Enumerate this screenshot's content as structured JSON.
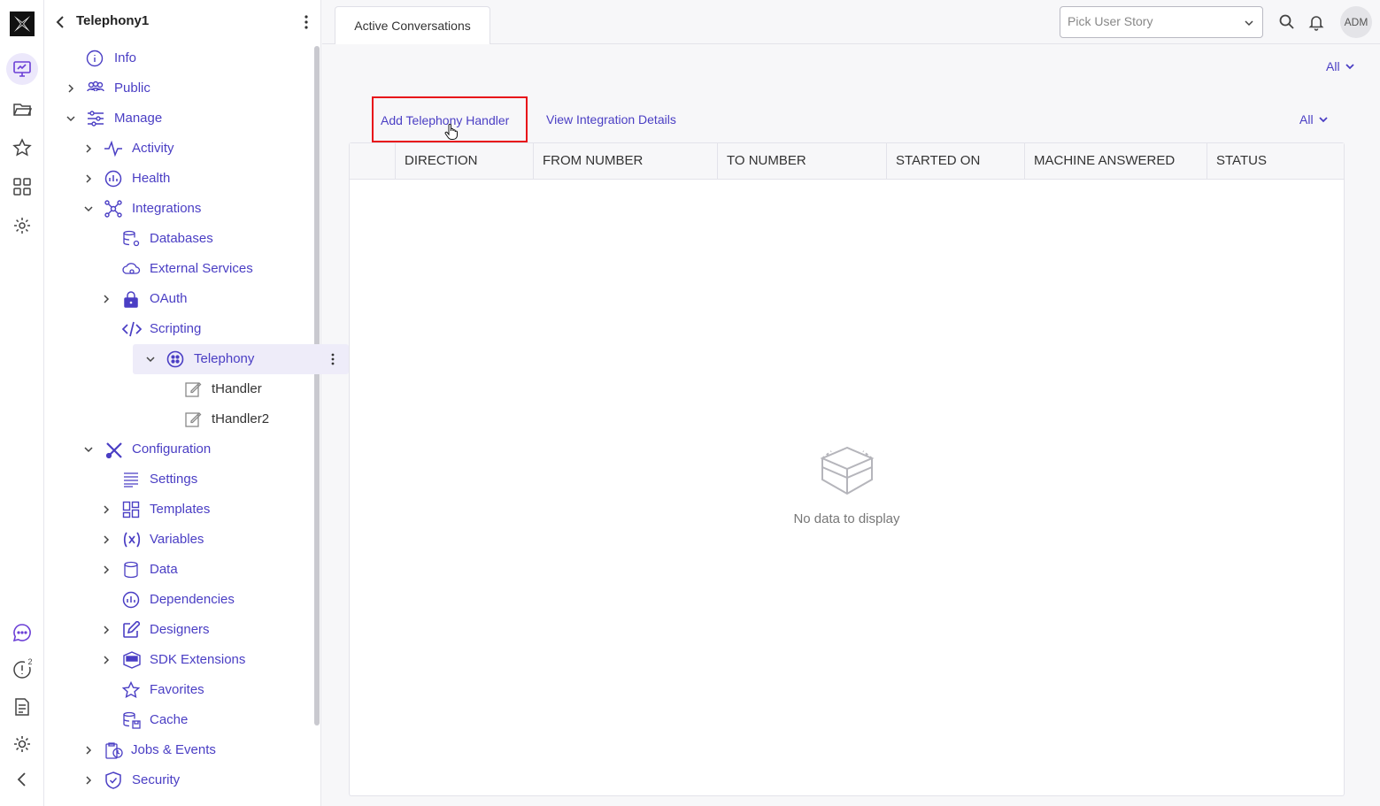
{
  "app": {
    "project_title": "Telephony1"
  },
  "rail": {
    "badge_count": "2"
  },
  "sidebar": {
    "items": [
      {
        "label": "Info",
        "icon": "info-icon"
      },
      {
        "label": "Public",
        "icon": "people-icon"
      },
      {
        "label": "Manage",
        "icon": "sliders-icon"
      },
      {
        "label": "Activity",
        "icon": "pulse-icon"
      },
      {
        "label": "Health",
        "icon": "gauge-icon"
      },
      {
        "label": "Integrations",
        "icon": "network-icon"
      },
      {
        "label": "Databases",
        "icon": "database-gear-icon"
      },
      {
        "label": "External Services",
        "icon": "cloud-gear-icon"
      },
      {
        "label": "OAuth",
        "icon": "lock-icon"
      },
      {
        "label": "Scripting",
        "icon": "code-icon"
      },
      {
        "label": "Telephony",
        "icon": "telephony-icon"
      },
      {
        "label": "tHandler",
        "icon": "edit-icon"
      },
      {
        "label": "tHandler2",
        "icon": "edit-icon"
      },
      {
        "label": "Configuration",
        "icon": "tools-icon"
      },
      {
        "label": "Settings",
        "icon": "lines-icon"
      },
      {
        "label": "Templates",
        "icon": "grid-icon"
      },
      {
        "label": "Variables",
        "icon": "variable-icon"
      },
      {
        "label": "Data",
        "icon": "cylinder-icon"
      },
      {
        "label": "Dependencies",
        "icon": "gauge-icon"
      },
      {
        "label": "Designers",
        "icon": "pencil-square-icon"
      },
      {
        "label": "SDK Extensions",
        "icon": "sdk-icon"
      },
      {
        "label": "Favorites",
        "icon": "star-icon"
      },
      {
        "label": "Cache",
        "icon": "database-save-icon"
      },
      {
        "label": "Jobs & Events",
        "icon": "clipboard-icon"
      },
      {
        "label": "Security",
        "icon": "shield-icon"
      }
    ]
  },
  "tabs": {
    "active": "Active Conversations"
  },
  "header": {
    "story_placeholder": "Pick User Story",
    "avatar": "ADM"
  },
  "main": {
    "filter_top": "All",
    "filter_table": "All",
    "add_handler": "Add Telephony Handler",
    "view_details": "View Integration Details",
    "columns": [
      "DIRECTION",
      "FROM NUMBER",
      "TO NUMBER",
      "STARTED ON",
      "MACHINE ANSWERED",
      "STATUS"
    ],
    "empty_text": "No data to display"
  },
  "colors": {
    "accent": "#4a3ec4",
    "highlight_border": "#e8111a"
  }
}
